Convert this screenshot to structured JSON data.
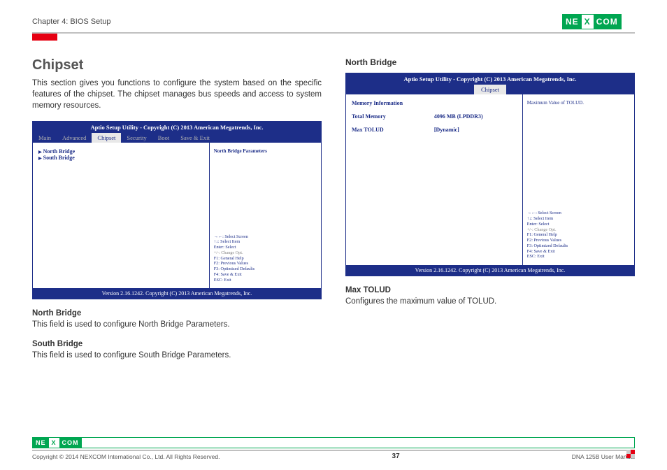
{
  "header": {
    "chapter": "Chapter 4: BIOS Setup",
    "logo1": "NE",
    "logoX": "X",
    "logo2": "COM"
  },
  "left": {
    "title": "Chipset",
    "intro": "This section gives you functions to configure the system based on the specific features of the chipset. The chipset manages bus speeds and access to system memory resources.",
    "bios": {
      "title": "Aptio Setup Utility - Copyright (C) 2013 American Megatrends, Inc.",
      "menu": {
        "main": "Main",
        "advanced": "Advanced",
        "chipset": "Chipset",
        "security": "Security",
        "boot": "Boot",
        "save": "Save & Exit"
      },
      "items": {
        "nb": "North Bridge",
        "sb": "South Bridge"
      },
      "rtop": "North Bridge Parameters",
      "help": {
        "l1": "→←: Select Screen",
        "l2": "↑↓: Select Item",
        "l3": "Enter: Select",
        "l4": "+/-: Change Opt.",
        "l5": "F1: General Help",
        "l6": "F2: Previous Values",
        "l7": "F3: Optimized Defaults",
        "l8": "F4: Save & Exit",
        "l9": "ESC: Exit"
      },
      "foot": "Version 2.16.1242. Copyright (C) 2013 American Megatrends, Inc."
    },
    "nb_h": "North Bridge",
    "nb_p": "This field is used to configure North Bridge Parameters.",
    "sb_h": "South Bridge",
    "sb_p": "This field is used to configure South Bridge Parameters."
  },
  "right": {
    "title": "North Bridge",
    "bios": {
      "title": "Aptio Setup Utility - Copyright (C) 2013 American Megatrends, Inc.",
      "tab": "Chipset",
      "mem_h": "Memory Information",
      "tm_l": "Total Memory",
      "tm_v": "4096 MB (LPDDR3)",
      "mt_l": "Max TOLUD",
      "mt_v": "[Dynamic]",
      "rtop": "Maximum Value of TOLUD.",
      "foot": "Version 2.16.1242. Copyright (C) 2013 American Megatrends, Inc."
    },
    "mt_h": "Max TOLUD",
    "mt_p": "Configures the maximum value of TOLUD."
  },
  "footer": {
    "copy": "Copyright © 2014 NEXCOM International Co., Ltd. All Rights Reserved.",
    "page": "37",
    "doc": "DNA 125B User Manual"
  }
}
